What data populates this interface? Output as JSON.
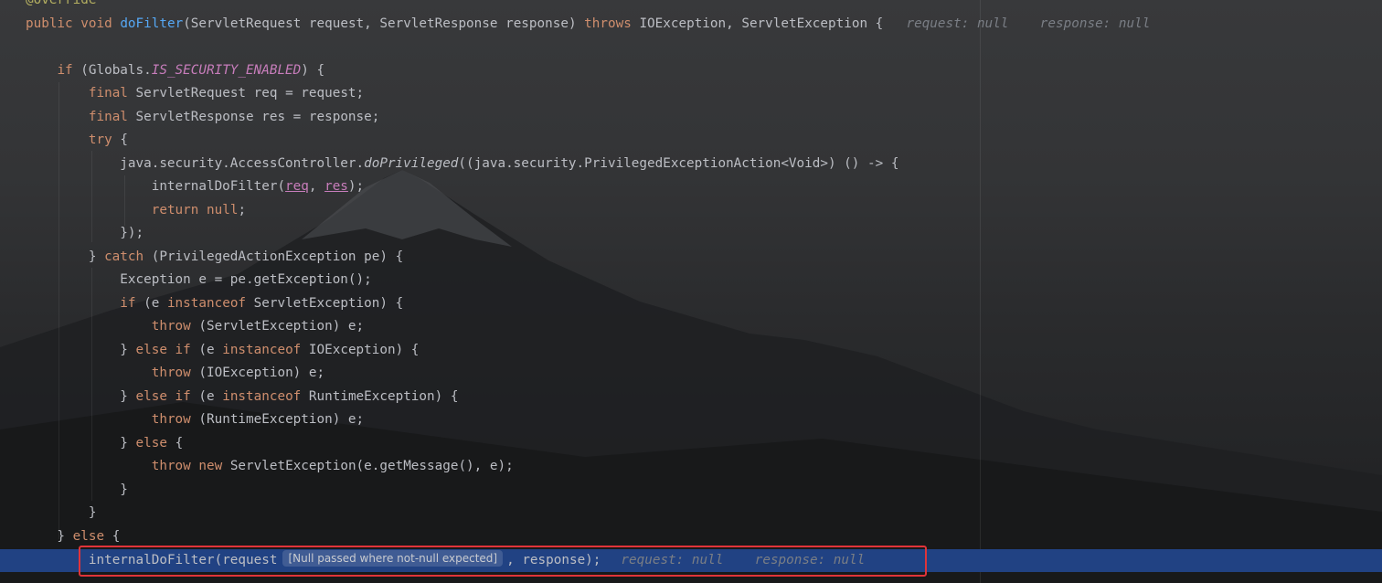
{
  "editor": {
    "lines": [
      {
        "id": "l0",
        "segments": [
          {
            "t": "@Override",
            "c": "ann"
          }
        ]
      },
      {
        "id": "l1",
        "segments": [
          {
            "t": "public ",
            "c": "kw"
          },
          {
            "t": "void ",
            "c": "kw"
          },
          {
            "t": "doFilter",
            "c": "fn"
          },
          {
            "t": "(ServletRequest request, ServletResponse response) "
          },
          {
            "t": "throws ",
            "c": "kw"
          },
          {
            "t": "IOException, ServletException {  "
          },
          {
            "t": "request: null    response: null",
            "c": "hint"
          }
        ]
      },
      {
        "id": "l2",
        "segments": []
      },
      {
        "id": "l3",
        "segments": [
          {
            "t": "    "
          },
          {
            "t": "if ",
            "c": "kw"
          },
          {
            "t": "(Globals."
          },
          {
            "t": "IS_SECURITY_ENABLED",
            "c": "const"
          },
          {
            "t": ") {"
          }
        ]
      },
      {
        "id": "l4",
        "segments": [
          {
            "t": "        "
          },
          {
            "t": "final ",
            "c": "kw"
          },
          {
            "t": "ServletRequest req = request;"
          }
        ]
      },
      {
        "id": "l5",
        "segments": [
          {
            "t": "        "
          },
          {
            "t": "final ",
            "c": "kw"
          },
          {
            "t": "ServletResponse res = response;"
          }
        ]
      },
      {
        "id": "l6",
        "segments": [
          {
            "t": "        "
          },
          {
            "t": "try ",
            "c": "kw"
          },
          {
            "t": "{"
          }
        ]
      },
      {
        "id": "l7",
        "segments": [
          {
            "t": "            java.security.AccessController."
          },
          {
            "t": "doPrivileged",
            "c": "it"
          },
          {
            "t": "((java.security.PrivilegedExceptionAction<Void>) () -> {"
          }
        ]
      },
      {
        "id": "l8",
        "segments": [
          {
            "t": "                internalDoFilter("
          },
          {
            "t": "req",
            "c": "ul"
          },
          {
            "t": ", "
          },
          {
            "t": "res",
            "c": "ul"
          },
          {
            "t": ");"
          }
        ]
      },
      {
        "id": "l9",
        "segments": [
          {
            "t": "                "
          },
          {
            "t": "return ",
            "c": "kw"
          },
          {
            "t": "null",
            "c": "kw"
          },
          {
            "t": ";"
          }
        ]
      },
      {
        "id": "l10",
        "segments": [
          {
            "t": "            });"
          }
        ]
      },
      {
        "id": "l11",
        "segments": [
          {
            "t": "        } "
          },
          {
            "t": "catch ",
            "c": "kw"
          },
          {
            "t": "(PrivilegedActionException pe) {"
          }
        ]
      },
      {
        "id": "l12",
        "segments": [
          {
            "t": "            Exception e = pe.getException();"
          }
        ]
      },
      {
        "id": "l13",
        "segments": [
          {
            "t": "            "
          },
          {
            "t": "if ",
            "c": "kw"
          },
          {
            "t": "(e "
          },
          {
            "t": "instanceof ",
            "c": "kw"
          },
          {
            "t": "ServletException) {"
          }
        ]
      },
      {
        "id": "l14",
        "segments": [
          {
            "t": "                "
          },
          {
            "t": "throw ",
            "c": "kw"
          },
          {
            "t": "(ServletException) e;"
          }
        ]
      },
      {
        "id": "l15",
        "segments": [
          {
            "t": "            } "
          },
          {
            "t": "else if ",
            "c": "kw"
          },
          {
            "t": "(e "
          },
          {
            "t": "instanceof ",
            "c": "kw"
          },
          {
            "t": "IOException) {"
          }
        ]
      },
      {
        "id": "l16",
        "segments": [
          {
            "t": "                "
          },
          {
            "t": "throw ",
            "c": "kw"
          },
          {
            "t": "(IOException) e;"
          }
        ]
      },
      {
        "id": "l17",
        "segments": [
          {
            "t": "            } "
          },
          {
            "t": "else if ",
            "c": "kw"
          },
          {
            "t": "(e "
          },
          {
            "t": "instanceof ",
            "c": "kw"
          },
          {
            "t": "RuntimeException) {"
          }
        ]
      },
      {
        "id": "l18",
        "segments": [
          {
            "t": "                "
          },
          {
            "t": "throw ",
            "c": "kw"
          },
          {
            "t": "(RuntimeException) e;"
          }
        ]
      },
      {
        "id": "l19",
        "segments": [
          {
            "t": "            } "
          },
          {
            "t": "else ",
            "c": "kw"
          },
          {
            "t": "{"
          }
        ]
      },
      {
        "id": "l20",
        "segments": [
          {
            "t": "                "
          },
          {
            "t": "throw ",
            "c": "kw"
          },
          {
            "t": "new ",
            "c": "kw"
          },
          {
            "t": "ServletException(e.getMessage(), e);"
          }
        ]
      },
      {
        "id": "l21",
        "segments": [
          {
            "t": "            }"
          }
        ]
      },
      {
        "id": "l22",
        "segments": [
          {
            "t": "        }"
          }
        ]
      },
      {
        "id": "l23",
        "segments": [
          {
            "t": "    } "
          },
          {
            "t": "else ",
            "c": "kw"
          },
          {
            "t": "{"
          }
        ]
      }
    ],
    "exec_line": {
      "indent": "        ",
      "call": "internalDoFilter(request",
      "inlay_warning": "[Null passed where not-null expected]",
      "rest": ", response);",
      "hint": "request: null    response: null"
    }
  },
  "colors": {
    "keyword": "#cf8e6d",
    "function": "#56a8f5",
    "annotation": "#b3ae60",
    "constant": "#c77dbb",
    "hint": "#7a7e85",
    "exec_line_bg": "#214283",
    "highlight_border": "#e0343a"
  }
}
